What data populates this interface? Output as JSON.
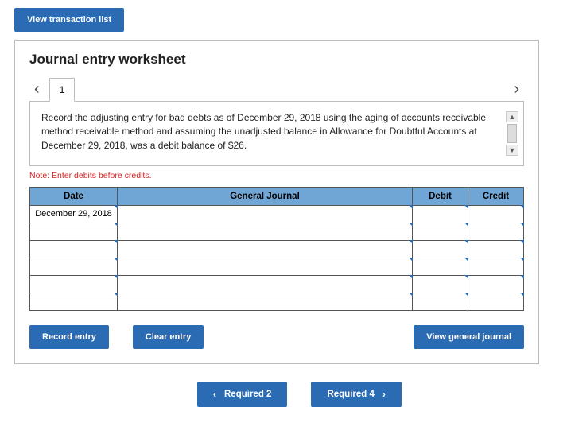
{
  "top_button": "View transaction list",
  "panel_title": "Journal entry worksheet",
  "tab_label": "1",
  "instruction": "Record the adjusting entry for bad debts as of December 29, 2018 using the aging of accounts receivable method receivable method and assuming the unadjusted balance in Allowance for Doubtful Accounts at December 29, 2018, was a debit balance of $26.",
  "note": "Note: Enter debits before credits.",
  "table": {
    "headers": {
      "date": "Date",
      "journal": "General Journal",
      "debit": "Debit",
      "credit": "Credit"
    },
    "rows": [
      {
        "date": "December 29, 2018",
        "journal": "",
        "debit": "",
        "credit": ""
      },
      {
        "date": "",
        "journal": "",
        "debit": "",
        "credit": ""
      },
      {
        "date": "",
        "journal": "",
        "debit": "",
        "credit": ""
      },
      {
        "date": "",
        "journal": "",
        "debit": "",
        "credit": ""
      },
      {
        "date": "",
        "journal": "",
        "debit": "",
        "credit": ""
      },
      {
        "date": "",
        "journal": "",
        "debit": "",
        "credit": ""
      }
    ]
  },
  "buttons": {
    "record": "Record entry",
    "clear": "Clear entry",
    "view_gj": "View general journal"
  },
  "nav": {
    "prev": "Required 2",
    "next": "Required 4"
  }
}
